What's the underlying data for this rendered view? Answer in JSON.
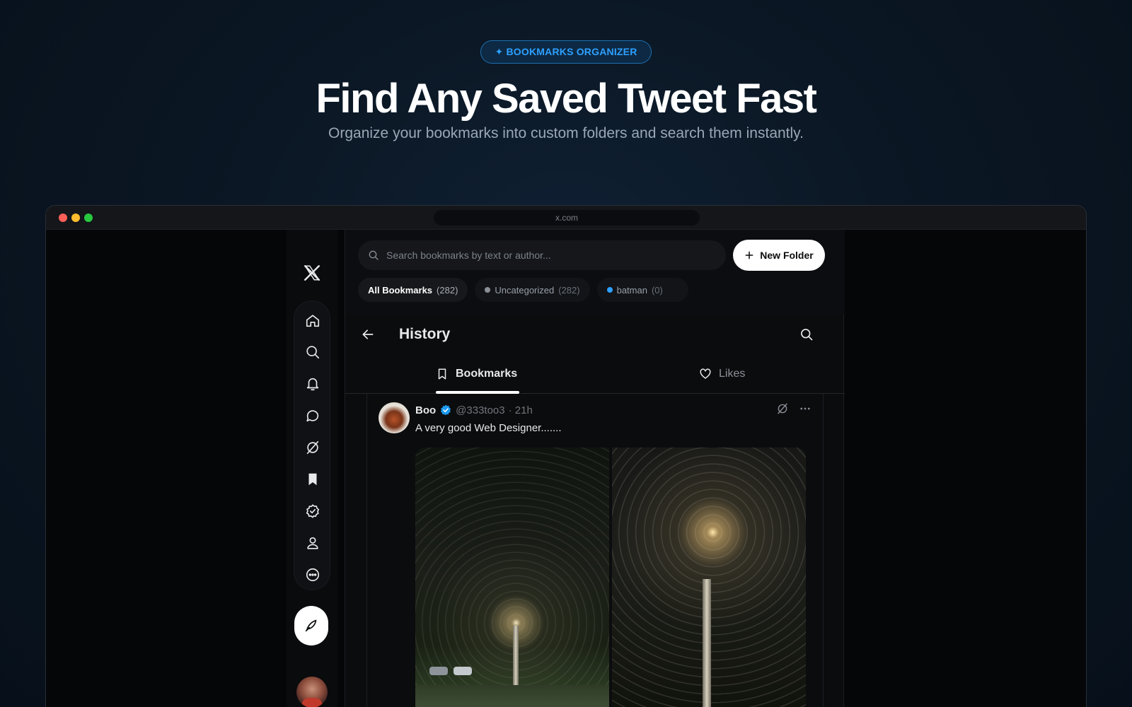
{
  "hero": {
    "badge": "✦ BOOKMARKS ORGANIZER",
    "title": "Find Any Saved Tweet Fast",
    "subtitle": "Organize your bookmarks into custom folders and search them instantly."
  },
  "browser": {
    "url": "x.com"
  },
  "nav": {
    "items": [
      "home-icon",
      "search-icon",
      "bell-icon",
      "message-icon",
      "grok-icon",
      "bookmark-icon",
      "verified-icon",
      "profile-icon",
      "more-icon"
    ],
    "compose_icon": "feather-icon"
  },
  "organizer": {
    "search_placeholder": "Search bookmarks by text or author...",
    "new_folder_label": "New Folder",
    "chips": [
      {
        "label": "All Bookmarks",
        "count": "(282)",
        "active": true,
        "dot": ""
      },
      {
        "label": "Uncategorized",
        "count": "(282)",
        "active": false,
        "dot": "#8b9097"
      },
      {
        "label": "batman",
        "count": "(0)",
        "active": false,
        "dot": "#2ea0ff"
      }
    ]
  },
  "page": {
    "title": "History",
    "tabs": [
      {
        "label": "Bookmarks",
        "icon": "bookmark-icon",
        "active": true
      },
      {
        "label": "Likes",
        "icon": "heart-icon",
        "active": false
      }
    ]
  },
  "tweet": {
    "name": "Boo",
    "handle": "@333too3",
    "time": "· 21h",
    "text": "A very good Web Designer......."
  },
  "colors": {
    "accent": "#2ea0ff",
    "verified": "#1d9bf0"
  }
}
